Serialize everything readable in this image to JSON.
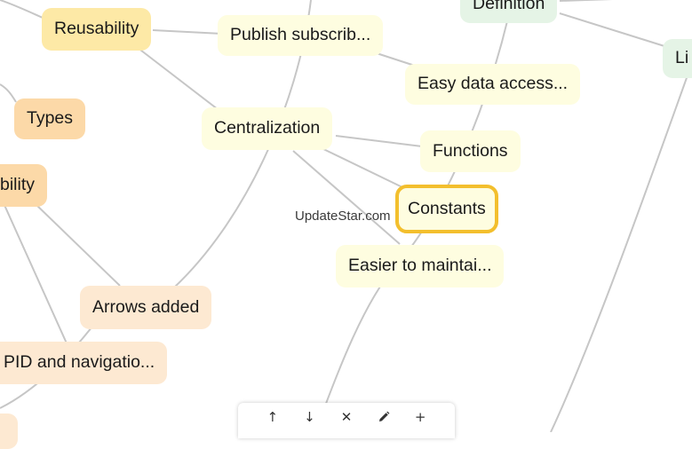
{
  "nodes": {
    "definition": "Definition",
    "link_partial": "Li",
    "reusability": "Reusability",
    "publish_subscribe": "Publish subscrib...",
    "easy_data_access": "Easy data access...",
    "types": "Types",
    "centralization": "Centralization",
    "functions": "Functions",
    "ability_partial": "bility",
    "constants": "Constants",
    "easier_to_maintain": "Easier to maintai...",
    "arrows_added": "Arrows added",
    "pid_navigation": "PID and navigatio..."
  },
  "watermark": "UpdateStar.com",
  "toolbar": {
    "move_up": "↑",
    "move_down": "↓",
    "delete": "✕",
    "add": "+"
  },
  "colors": {
    "selected_border": "#f3bf2d",
    "node_yellow": "#fefde0",
    "node_gold": "#fde9a6",
    "node_orange": "#fcd9a8",
    "node_peach": "#fde9d2",
    "node_green": "#e5f4e6"
  }
}
